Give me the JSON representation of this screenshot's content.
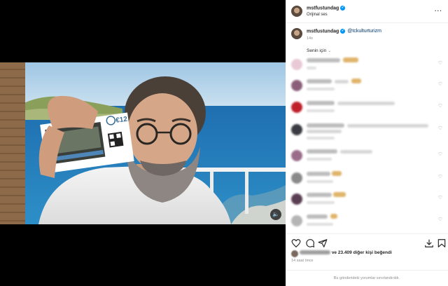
{
  "header": {
    "username": "mstfustundag",
    "audio": "Orijinal ses",
    "more_icon": "more-horizontal-icon"
  },
  "caption": {
    "username": "mstfustundag",
    "mention": "@tckulturturizm",
    "time": "14s"
  },
  "comments": {
    "sort_label": "Senin için",
    "sort_icon": "chevron-down-icon"
  },
  "actions": {
    "icons": [
      "heart-icon",
      "comment-icon",
      "share-icon",
      "download-icon",
      "bookmark-icon"
    ]
  },
  "likes": {
    "text": "ve 23.409 diğer kişi beğendi"
  },
  "posted": "14 saat önce",
  "limited_notice": "Bu gönderideki yorumlar sınırlandırıldı.",
  "media": {
    "mute_icon": "volume-icon",
    "ticket_price": "€12"
  },
  "colors": {
    "verified": "#0095f6",
    "link": "#00376b",
    "secondary_text": "#8e8e8e"
  }
}
